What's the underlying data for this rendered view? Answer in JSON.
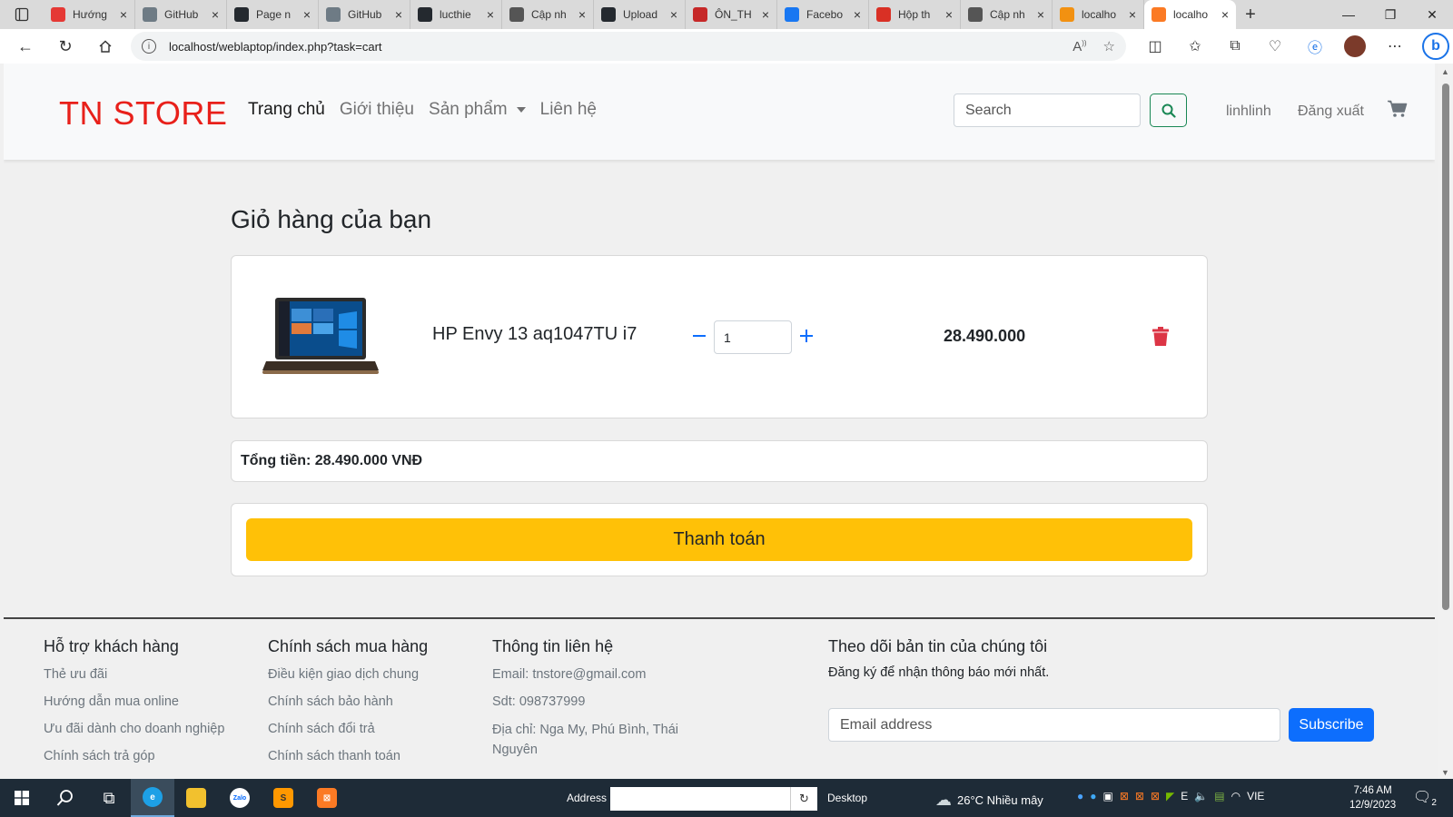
{
  "browser": {
    "tabs": [
      {
        "title": "Hướng",
        "icon": "youtube-icon",
        "color": "#e53935"
      },
      {
        "title": "GitHub",
        "icon": "github-thumb-icon",
        "color": "#6e7b85"
      },
      {
        "title": "Page n",
        "icon": "github-icon",
        "color": "#24292f"
      },
      {
        "title": "GitHub",
        "icon": "github-thumb-icon",
        "color": "#6e7b85"
      },
      {
        "title": "lucthiе",
        "icon": "github-icon",
        "color": "#24292f"
      },
      {
        "title": "Cập nh",
        "icon": "document-icon",
        "color": "#555555"
      },
      {
        "title": "Upload",
        "icon": "github-icon",
        "color": "#24292f"
      },
      {
        "title": "ÔN_TH",
        "icon": "pdf-icon",
        "color": "#c62828"
      },
      {
        "title": "Facebo",
        "icon": "facebook-icon",
        "color": "#1877f2"
      },
      {
        "title": "Hộp th",
        "icon": "gmail-icon",
        "color": "#d93025"
      },
      {
        "title": "Cập nh",
        "icon": "document-icon",
        "color": "#555555"
      },
      {
        "title": "localho",
        "icon": "phpmyadmin-icon",
        "color": "#f29111"
      },
      {
        "title": "localho",
        "icon": "xampp-icon",
        "color": "#fb7a24",
        "active": true
      }
    ],
    "url": "localhost/weblaptop/index.php?task=cart"
  },
  "nav": {
    "brand": "TN STORE",
    "links": [
      "Trang chủ",
      "Giới thiệu",
      "Sản phẩm",
      "Liên hệ"
    ],
    "search_placeholder": "Search",
    "user": "linhlinh",
    "logout": "Đăng xuất"
  },
  "cart": {
    "title": "Giỏ hàng của bạn",
    "items": [
      {
        "name": "HP Envy 13 aq1047TU i7",
        "quantity": "1",
        "price": "28.490.000"
      }
    ],
    "total": "Tổng tiền: 28.490.000 VNĐ",
    "checkout_label": "Thanh toán"
  },
  "footer": {
    "support": {
      "title": "Hỗ trợ khách hàng",
      "items": [
        "Thẻ ưu đãi",
        "Hướng dẫn mua online",
        "Ưu đãi dành cho doanh nghiệp",
        "Chính sách trả góp"
      ]
    },
    "policy": {
      "title": "Chính sách mua hàng",
      "items": [
        "Điều kiện giao dịch chung",
        "Chính sách bảo hành",
        "Chính sách đổi trả",
        "Chính sách thanh toán"
      ]
    },
    "contact": {
      "title": "Thông tin liên hệ",
      "email": "Email: tnstore@gmail.com",
      "phone": "Sdt: 098737999",
      "address": "Địa chỉ: Nga My, Phú Bình, Thái Nguyên"
    },
    "newsletter": {
      "title": "Theo dõi bản tin của chúng tôi",
      "description": "Đăng ký để nhận thông báo mới nhất.",
      "placeholder": "Email address",
      "button": "Subscribe"
    }
  },
  "taskbar": {
    "address_label": "Address",
    "desktop_label": "Desktop",
    "weather": "26°C  Nhiều mây",
    "language": "VIE",
    "time": "7:46 AM",
    "date": "12/9/2023",
    "notifications": "2"
  },
  "colors": {
    "brand": "#e8201a",
    "accent_blue": "#0d6efd",
    "checkout_yellow": "#ffc107",
    "search_green": "#198754",
    "delete_red": "#dc3545"
  }
}
